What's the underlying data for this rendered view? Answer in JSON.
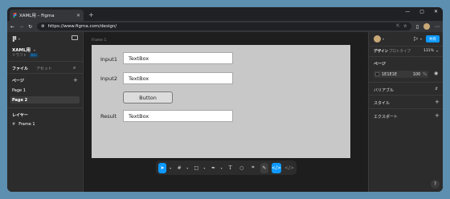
{
  "browser": {
    "tab_title": "XAML用 – Figma",
    "tab_close": "✕",
    "new_tab": "+",
    "url": "https://www.figma.com/design/",
    "win_min": "—",
    "win_max": "▢",
    "win_close": "✕"
  },
  "left_panel": {
    "file_name": "XAML用",
    "file_sub": "ドラフト",
    "badge": "無料",
    "tab_file": "ファイル",
    "tab_assets": "アセット",
    "pages_title": "ページ",
    "pages": [
      "Page 1",
      "Page 2"
    ],
    "layers_title": "レイヤー",
    "layers": [
      "Frame 1"
    ]
  },
  "canvas": {
    "frame_label": "Frame 1",
    "rows": [
      {
        "label": "Input1",
        "box": "TextBox"
      },
      {
        "label": "Input2",
        "box": "TextBox"
      },
      {
        "label": "Result",
        "box": "TextBox"
      }
    ],
    "button_label": "Button"
  },
  "right_panel": {
    "share_label": "共有",
    "tab_design": "デザイン",
    "tab_prototype": "プロトタイプ",
    "zoom": "131%",
    "page_section": "ページ",
    "bg_hex": "1E1E1E",
    "bg_opacity": "100",
    "bg_pct": "%",
    "variables": "バリアブル",
    "styles": "スタイル",
    "export": "エクスポート"
  },
  "help": "?",
  "colors": {
    "accent": "#0d99ff",
    "frame_bg": "#c8c8c8",
    "canvas_bg": "#1e1e1e"
  }
}
